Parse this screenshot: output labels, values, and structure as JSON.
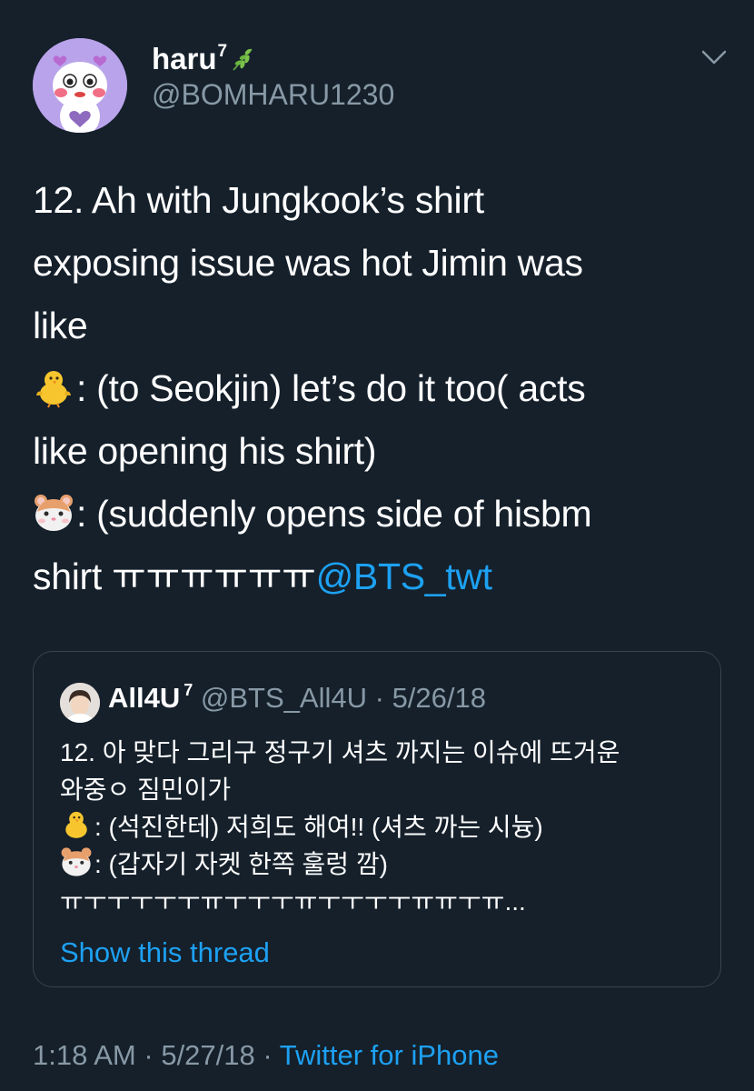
{
  "author": {
    "display_name": "haru",
    "name_superscript": "7",
    "handle": "@BOMHARU1230",
    "avatar_icon": "cartoon-bear-avatar-icon",
    "name_badge_icon": "herb-leaf-icon"
  },
  "tweet": {
    "lines": [
      "12. Ah with Jungkook’s shirt",
      "exposing issue was hot Jimin was",
      "like",
      ": (to Seokjin) let’s do it too( acts",
      "like opening his shirt)",
      ": (suddenly opens side of hisbm",
      "shirt ㅠㅠㅠㅠㅠㅠ"
    ],
    "line4_emoji": "baby-chick-emoji-icon",
    "line6_emoji": "hamster-face-emoji-icon",
    "mention": "@BTS_twt"
  },
  "quote": {
    "display_name": "All4U",
    "name_superscript": "7",
    "handle": "@BTS_All4U",
    "separator": "·",
    "date": "5/26/18",
    "lines": [
      "12. 아 맞다 그리구 정구기 셔츠 까지는 이슈에 뜨거운",
      "와중ㅇ 짐민이가",
      ": (석진한테) 저희도 해여!! (셔츠 까는 시늉)",
      ": (갑자기 자켓 한쪽 훌렁 깜)",
      "ㅠㅜㅜㅜㅜㅜㅠㅜㅜㅜㅠㅜㅜㅜㅜㅠㅠㅜㅠ..."
    ],
    "show_thread": "Show this thread"
  },
  "footer": {
    "time": "1:18 AM",
    "separator": "·",
    "date": "5/27/18",
    "source": "Twitter for iPhone"
  },
  "colors": {
    "background": "#15202b",
    "text": "#ffffff",
    "secondary": "#8899a6",
    "link": "#1da1f2",
    "border": "#38444d",
    "avatar_bg": "#b9a3ea"
  }
}
